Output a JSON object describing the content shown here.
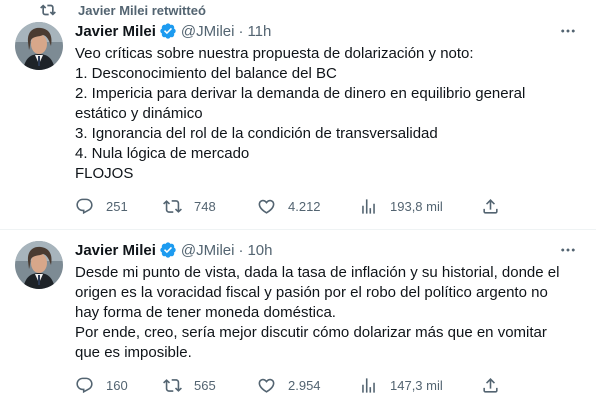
{
  "retweet_banner": {
    "text": "Javier Milei retwitteó",
    "icon": "retweet-icon"
  },
  "tweets": [
    {
      "author_name": "Javier Milei",
      "handle": "@JMilei",
      "separator": "·",
      "time": "11h",
      "verified_icon": "verified-badge-icon",
      "body_lines": [
        "Veo críticas sobre nuestra propuesta de dolarización y noto:",
        "1. Desconocimiento del balance del BC",
        "2. Impericia para derivar la demanda de dinero en equilibrio general",
        "estático y dinámico",
        "3. Ignorancia del rol de la condición de transversalidad",
        "4. Nula lógica de mercado",
        "FLOJOS"
      ],
      "replies": "251",
      "retweets": "748",
      "likes": "4.212",
      "views": "193,8 mil"
    },
    {
      "author_name": "Javier Milei",
      "handle": "@JMilei",
      "separator": "·",
      "time": "10h",
      "verified_icon": "verified-badge-icon",
      "body_lines": [
        "Desde mi punto de vista, dada la tasa de inflación y su historial, donde el",
        "origen es la voracidad fiscal y pasión por el robo del político argento no",
        "hay forma de tener moneda doméstica.",
        "Por ende, creo, sería mejor discutir cómo dolarizar más que en vomitar",
        "que es imposible."
      ],
      "replies": "160",
      "retweets": "565",
      "likes": "2.954",
      "views": "147,3 mil"
    }
  ],
  "colors": {
    "text_primary": "#0f1419",
    "text_secondary": "#536471",
    "verified_blue": "#1d9bf0",
    "divider": "#eff3f4"
  }
}
